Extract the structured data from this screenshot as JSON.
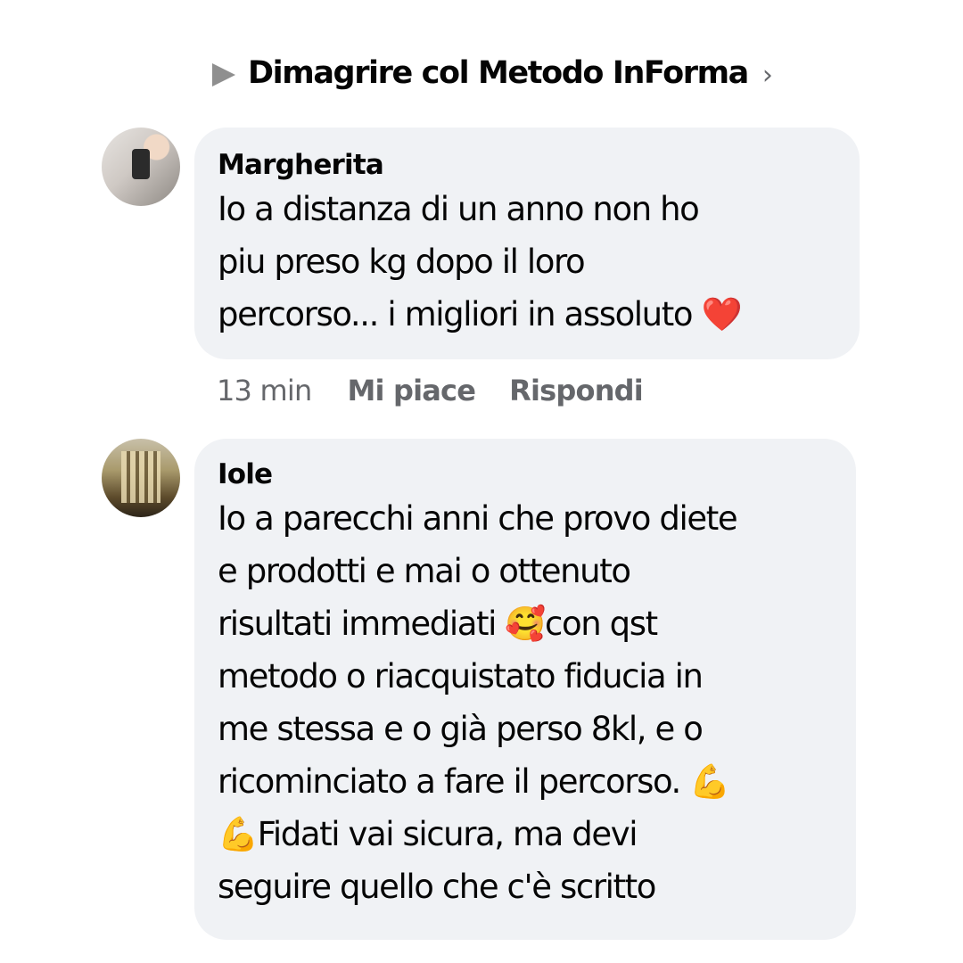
{
  "header": {
    "group_name": "Dimagrire col Metodo InForma",
    "play_glyph": "▶",
    "chevron_glyph": "›"
  },
  "comments": [
    {
      "author": "Margherita",
      "lines": [
        "Io a distanza di un anno non ho",
        "piu preso kg dopo il loro",
        "percorso... i migliori in assoluto ❤️"
      ],
      "time": "13 min",
      "like_label": "Mi piace",
      "reply_label": "Rispondi"
    },
    {
      "author": "Iole",
      "lines": [
        "Io a parecchi anni che provo diete",
        "e prodotti e mai o ottenuto",
        "risultati immediati 🥰con qst",
        "metodo o riacquistato fiducia in",
        "me stessa e o già perso 8kl, e o",
        "ricominciato a fare il percorso. 💪",
        "💪Fidati vai sicura, ma devi",
        "seguire quello che c'è scritto"
      ]
    }
  ],
  "colors": {
    "bubble_bg": "#f0f2f5",
    "text": "#050505",
    "secondary_text": "#65676b",
    "play_icon": "#8f8f8f"
  }
}
